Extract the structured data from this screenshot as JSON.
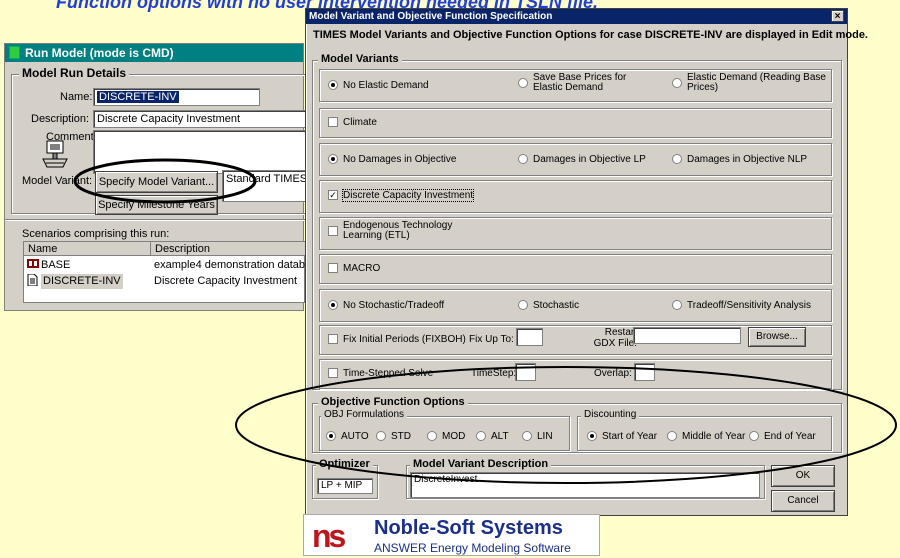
{
  "banner": "Function options with no user intervention needed in TSLN file.",
  "run_model": {
    "title": "Run Model (mode is CMD)",
    "group_title": "Model Run Details",
    "name_label": "Name:",
    "name_value": "DISCRETE-INV",
    "description_label": "Description:",
    "description_value": "Discrete Capacity Investment",
    "comment_label": "Comment:",
    "model_variant_label": "Model Variant:",
    "specify_variant_button": "Specify Model Variant...",
    "variant_value": "Standard TIMES",
    "specify_milestone_button": "Specify Milestone Years",
    "scenarios_label": "Scenarios comprising this run:",
    "columns": [
      "Name",
      "Description"
    ],
    "rows": [
      {
        "name": "BASE",
        "description": "example4 demonstration databa"
      },
      {
        "name": "DISCRETE-INV",
        "description": "Discrete Capacity Investment"
      }
    ]
  },
  "dialog": {
    "title": "Model Variant and Objective Function Specification",
    "close": "×",
    "subtitle": "TIMES Model Variants and Objective Function Options for case DISCRETE-INV are displayed in Edit mode.",
    "model_variants_title": "Model Variants",
    "elastic": [
      "No Elastic Demand",
      "Save Base Prices for Elastic Demand",
      "Elastic Demand (Reading Base Prices)"
    ],
    "climate": "Climate",
    "damages": [
      "No Damages in Objective",
      "Damages in Objective LP",
      "Damages in Objective NLP"
    ],
    "discrete": "Discrete Capacity Investment",
    "etl": "Endogenous Technology Learning (ETL)",
    "macro": "MACRO",
    "stochastic": [
      "No Stochastic/Tradeoff",
      "Stochastic",
      "Tradeoff/Sensitivity Analysis"
    ],
    "fix_initial": "Fix Initial Periods (FIXBOH)",
    "fix_up_to": "Fix Up To:",
    "restart": "Restart",
    "gdx_file": "GDX File:",
    "browse": "Browse...",
    "time_stepped": "Time-Stepped Solve",
    "timestep": "TimeStep:",
    "overlap": "Overlap:",
    "objective_title": "Objective Function Options",
    "obj_formulations_title": "OBJ Formulations",
    "obj_formulations": [
      "AUTO",
      "STD",
      "MOD",
      "ALT",
      "LIN"
    ],
    "discounting_title": "Discounting",
    "discounting": [
      "Start of Year",
      "Middle of Year",
      "End of Year"
    ],
    "optimizer_title": "Optimizer",
    "optimizer_value": "LP + MIP",
    "description_title": "Model Variant Description",
    "description_value": "DiscreteInvest",
    "ok": "OK",
    "cancel": "Cancel"
  },
  "logo": {
    "mark": "ns",
    "name": "Noble-Soft Systems",
    "tagline": "ANSWER Energy Modeling Software"
  }
}
